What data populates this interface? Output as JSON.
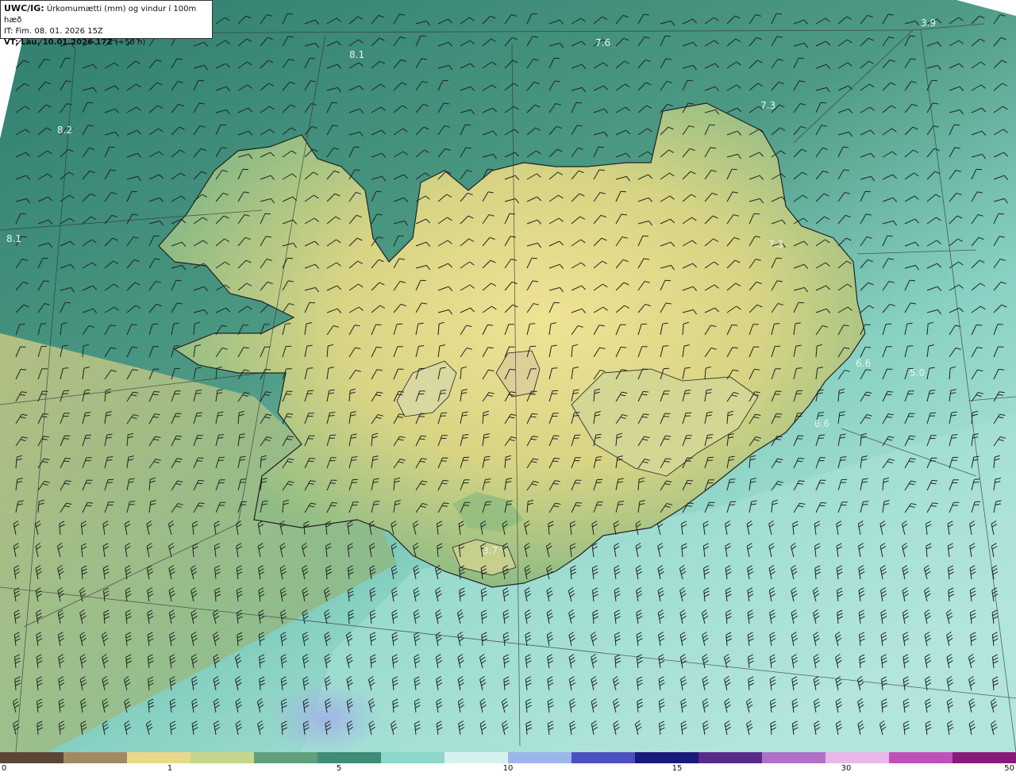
{
  "header": {
    "line1_prefix": "UWC/IG:",
    "line1_text": "Úrkomumætti (mm) og vindur í 100m hæð",
    "line2": "IT: Fim. 08. 01. 2026 15Z",
    "line3_prefix": "VT:",
    "line3_date": "Lau. 10.01.2026 17Z",
    "line3_suffix": "(+50 h)"
  },
  "point_labels": [
    "8.1",
    "7.6",
    "3.9",
    "7.3",
    "8.2",
    "8.1",
    "7.3",
    "6.6",
    "5.0",
    "6.6",
    "3.7"
  ],
  "colorbar": {
    "ticks": [
      "0",
      "1",
      "5",
      "10",
      "15",
      "30",
      "50"
    ],
    "colors": [
      "#5a4638",
      "#a08a64",
      "#e8d88a",
      "#c7d68c",
      "#5f9f7e",
      "#3f8c78",
      "#8fd6cc",
      "#d6f2f0",
      "#9bb6e8",
      "#4b4fc0",
      "#1a1a7a",
      "#5a2a8a",
      "#b070c8",
      "#e8b8e8",
      "#c050b8",
      "#8a1a7a"
    ]
  },
  "colors": {
    "land_high": "#eadf8c",
    "land_mid": "#b8c77e",
    "sea_deep": "#2f7e6f",
    "sea_light": "#a6e0d6",
    "sea_pale": "#d4f2ee",
    "outline": "#222222"
  },
  "icons": {
    "wind_barb": "wind-barb-icon"
  }
}
